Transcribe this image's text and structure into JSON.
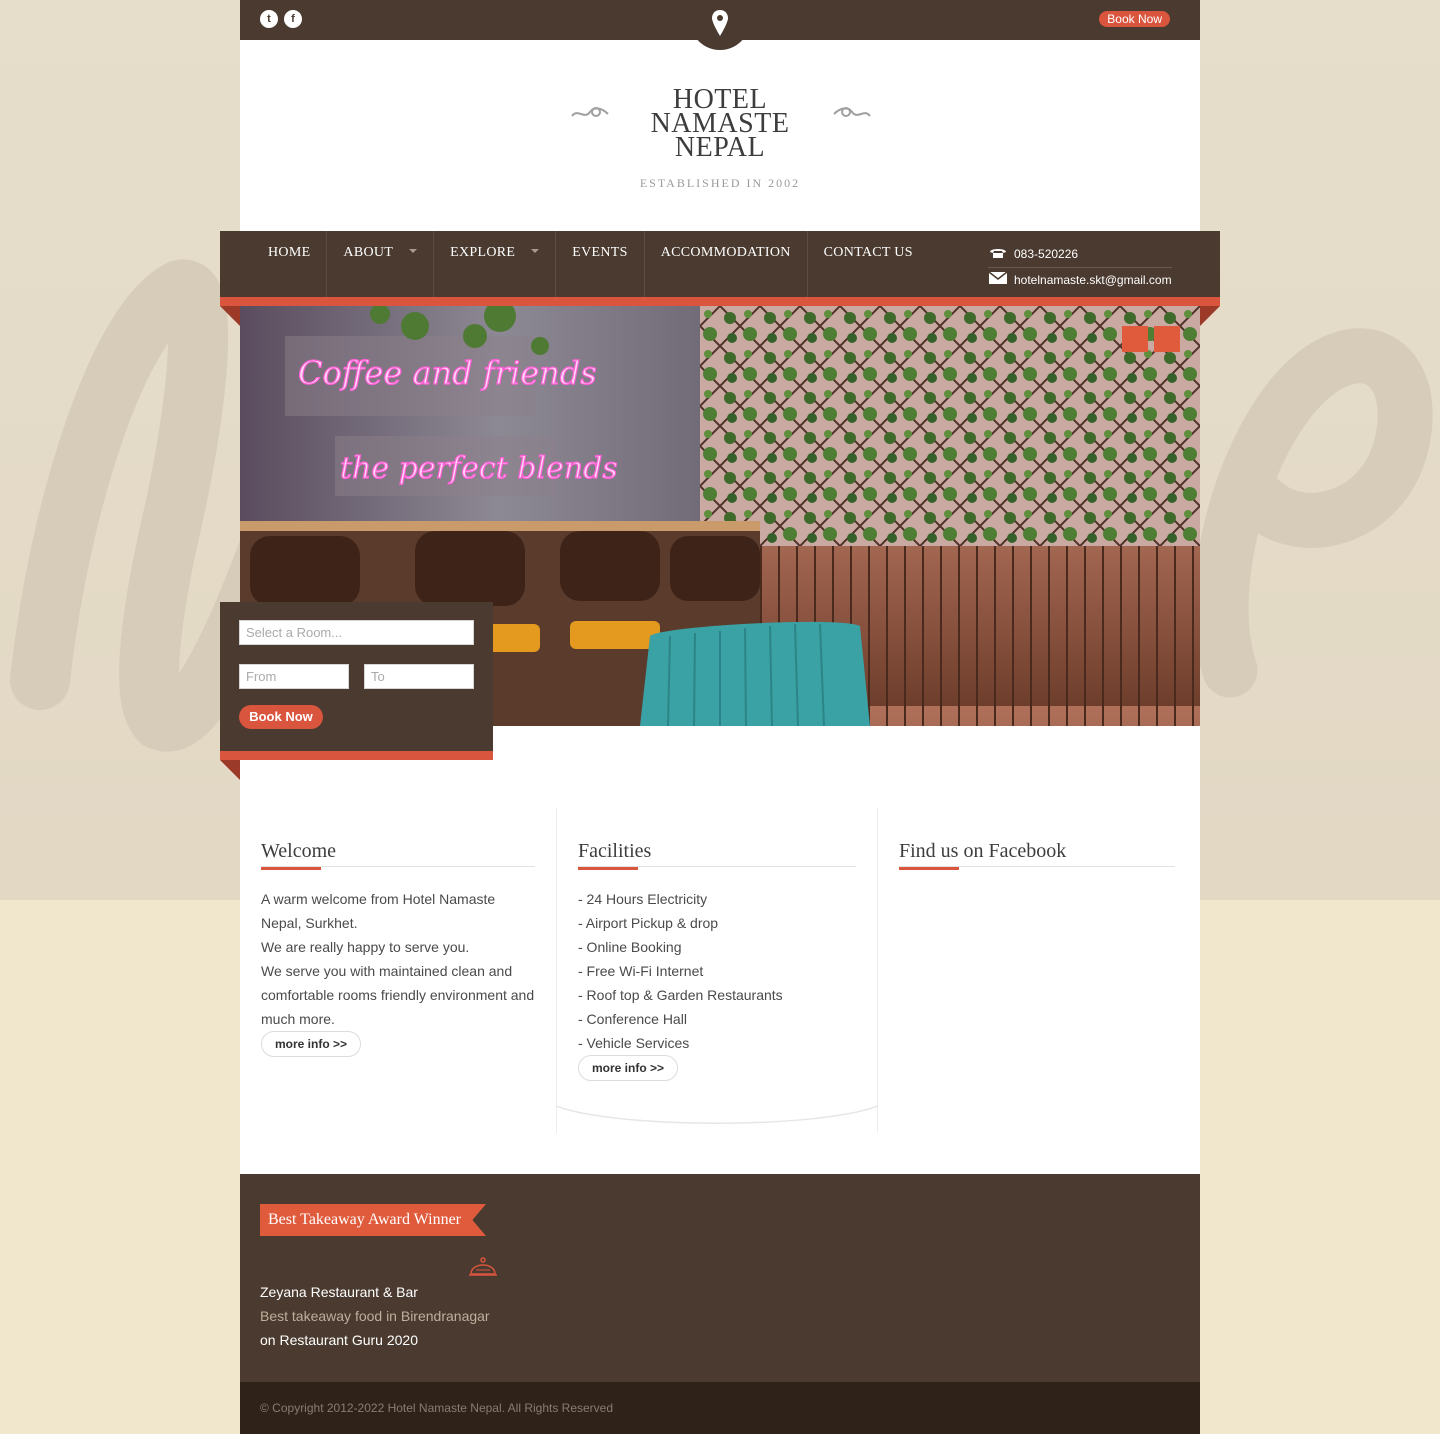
{
  "colors": {
    "brown": "#4a3a2f",
    "accent": "#d9553e",
    "page_bg": "#e2d8c4",
    "dark_footer": "#2f2218"
  },
  "topbar": {
    "social": [
      {
        "icon": "twitter-icon",
        "glyph": "t"
      },
      {
        "icon": "facebook-icon",
        "glyph": "f"
      }
    ],
    "center_icon": "map-pin-icon",
    "book_now": "Book Now"
  },
  "logo": {
    "line1": "HOTEL",
    "line2": "NAMASTE",
    "line3": "NEPAL",
    "subtitle": "ESTABLISHED IN 2002"
  },
  "nav": {
    "items": [
      {
        "label": "HOME",
        "dropdown": false
      },
      {
        "label": "ABOUT",
        "dropdown": true
      },
      {
        "label": "EXPLORE",
        "dropdown": true
      },
      {
        "label": "EVENTS",
        "dropdown": false
      },
      {
        "label": "ACCOMMODATION",
        "dropdown": false
      },
      {
        "label": "CONTACT US",
        "dropdown": false
      }
    ],
    "phone": "083-520226",
    "email": "hotelnamaste.skt@gmail.com"
  },
  "hero": {
    "neon1": "Coffee and friends",
    "neon2": "the perfect blends"
  },
  "booking": {
    "room_placeholder": "Select a Room...",
    "from_placeholder": "From",
    "to_placeholder": "To",
    "button": "Book Now"
  },
  "welcome": {
    "title": "Welcome",
    "lines": [
      "A warm welcome from Hotel Namaste Nepal, Surkhet.",
      "We are really happy to serve you.",
      "We serve you with maintained clean and comfortable rooms friendly environment and much more."
    ],
    "more": "more info >>"
  },
  "facilities": {
    "title": "Facilities",
    "items": [
      "- 24 Hours Electricity",
      "- Airport Pickup & drop",
      "- Online Booking",
      "- Free Wi-Fi Internet",
      "- Roof top & Garden Restaurants",
      "- Conference Hall",
      "- Vehicle Services"
    ],
    "more": "more info >>"
  },
  "facebook": {
    "title": "Find us on Facebook"
  },
  "footer": {
    "ribbon": "Best Takeaway Award Winner",
    "award_line1": "Zeyana Restaurant & Bar",
    "award_line2": "Best takeaway food in Birendranagar",
    "award_line3": "on Restaurant Guru 2020",
    "copyright": "© Copyright 2012-2022 Hotel Namaste Nepal. All Rights Reserved"
  }
}
